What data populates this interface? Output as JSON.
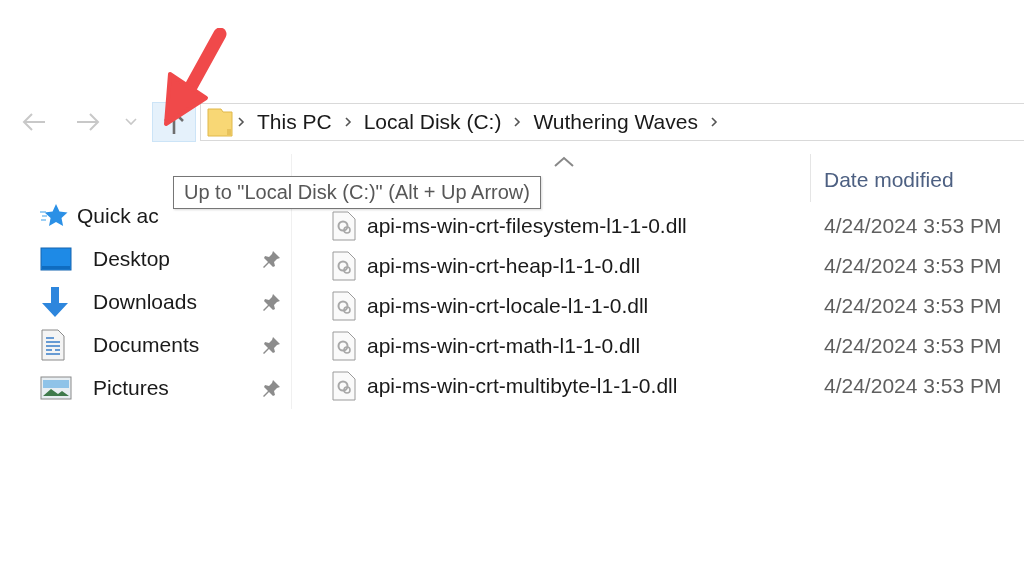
{
  "nav_buttons": [
    {
      "kind": "back",
      "disabled": true,
      "highlighted": false
    },
    {
      "kind": "forward",
      "disabled": true,
      "highlighted": false
    },
    {
      "kind": "recent",
      "disabled": true,
      "highlighted": false
    },
    {
      "kind": "up",
      "disabled": false,
      "highlighted": true
    }
  ],
  "breadcrumb": [
    "This PC",
    "Local Disk (C:)",
    "Wuthering Waves"
  ],
  "tooltip": "Up to \"Local Disk (C:)\" (Alt + Up Arrow)",
  "sidebar": {
    "items": [
      {
        "label": "Quick ac",
        "kind": "quick",
        "pinned": false
      },
      {
        "label": "Desktop",
        "kind": "desktop",
        "pinned": true
      },
      {
        "label": "Downloads",
        "kind": "downloads",
        "pinned": true
      },
      {
        "label": "Documents",
        "kind": "documents",
        "pinned": true
      },
      {
        "label": "Pictures",
        "kind": "pictures",
        "pinned": true
      }
    ]
  },
  "table": {
    "sort_ascending": true,
    "columns": [
      "Date modified"
    ],
    "rows": [
      {
        "name": "api-ms-win-crt-filesystem-l1-1-0.dll",
        "date_modified": "4/24/2024 3:53 PM"
      },
      {
        "name": "api-ms-win-crt-heap-l1-1-0.dll",
        "date_modified": "4/24/2024 3:53 PM"
      },
      {
        "name": "api-ms-win-crt-locale-l1-1-0.dll",
        "date_modified": "4/24/2024 3:53 PM"
      },
      {
        "name": "api-ms-win-crt-math-l1-1-0.dll",
        "date_modified": "4/24/2024 3:53 PM"
      },
      {
        "name": "api-ms-win-crt-multibyte-l1-1-0.dll",
        "date_modified": "4/24/2024 3:53 PM"
      }
    ]
  }
}
